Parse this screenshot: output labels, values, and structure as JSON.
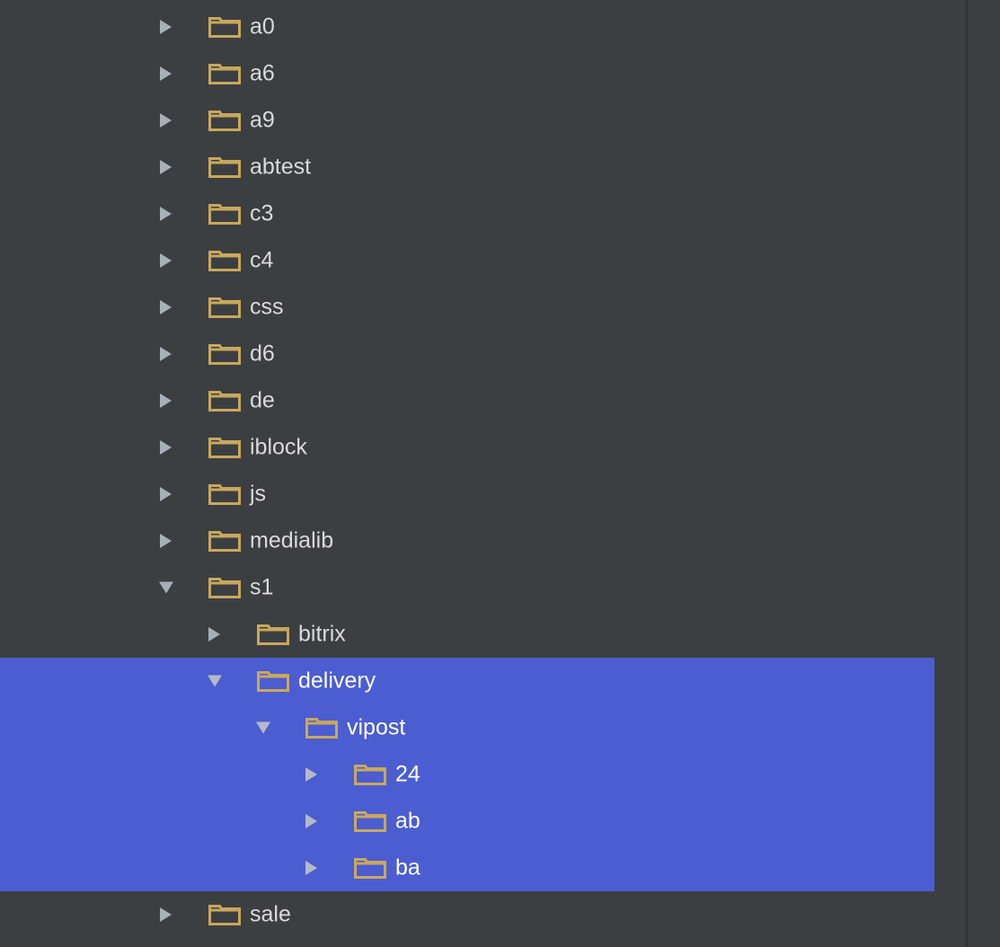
{
  "colors": {
    "background": "#3c3f41",
    "selection": "#4b5dd1",
    "folder": "#c9a85c",
    "text": "#d8dadc",
    "selected_text": "#ffffff",
    "arrow": "#a9afb6"
  },
  "tree": {
    "rows": [
      {
        "label": "a0",
        "state": "collapsed",
        "level": 0,
        "selected": false,
        "icon": "folder-icon"
      },
      {
        "label": "a6",
        "state": "collapsed",
        "level": 0,
        "selected": false,
        "icon": "folder-icon"
      },
      {
        "label": "a9",
        "state": "collapsed",
        "level": 0,
        "selected": false,
        "icon": "folder-icon"
      },
      {
        "label": "abtest",
        "state": "collapsed",
        "level": 0,
        "selected": false,
        "icon": "folder-icon"
      },
      {
        "label": "c3",
        "state": "collapsed",
        "level": 0,
        "selected": false,
        "icon": "folder-icon"
      },
      {
        "label": "c4",
        "state": "collapsed",
        "level": 0,
        "selected": false,
        "icon": "folder-icon"
      },
      {
        "label": "css",
        "state": "collapsed",
        "level": 0,
        "selected": false,
        "icon": "folder-icon"
      },
      {
        "label": "d6",
        "state": "collapsed",
        "level": 0,
        "selected": false,
        "icon": "folder-icon"
      },
      {
        "label": "de",
        "state": "collapsed",
        "level": 0,
        "selected": false,
        "icon": "folder-icon"
      },
      {
        "label": "iblock",
        "state": "collapsed",
        "level": 0,
        "selected": false,
        "icon": "folder-icon"
      },
      {
        "label": "js",
        "state": "collapsed",
        "level": 0,
        "selected": false,
        "icon": "folder-icon"
      },
      {
        "label": "medialib",
        "state": "collapsed",
        "level": 0,
        "selected": false,
        "icon": "folder-icon"
      },
      {
        "label": "s1",
        "state": "expanded",
        "level": 0,
        "selected": false,
        "icon": "folder-icon"
      },
      {
        "label": "bitrix",
        "state": "collapsed",
        "level": 1,
        "selected": false,
        "icon": "folder-icon"
      },
      {
        "label": "delivery",
        "state": "expanded",
        "level": 1,
        "selected": true,
        "icon": "folder-icon"
      },
      {
        "label": "vipost",
        "state": "expanded",
        "level": 2,
        "selected": true,
        "icon": "folder-icon"
      },
      {
        "label": "24",
        "state": "collapsed",
        "level": 3,
        "selected": true,
        "icon": "folder-icon"
      },
      {
        "label": "ab",
        "state": "collapsed",
        "level": 3,
        "selected": true,
        "icon": "folder-icon"
      },
      {
        "label": "ba",
        "state": "collapsed",
        "level": 3,
        "selected": true,
        "icon": "folder-icon"
      },
      {
        "label": "sale",
        "state": "collapsed",
        "level": 0,
        "selected": false,
        "icon": "folder-icon"
      }
    ]
  }
}
